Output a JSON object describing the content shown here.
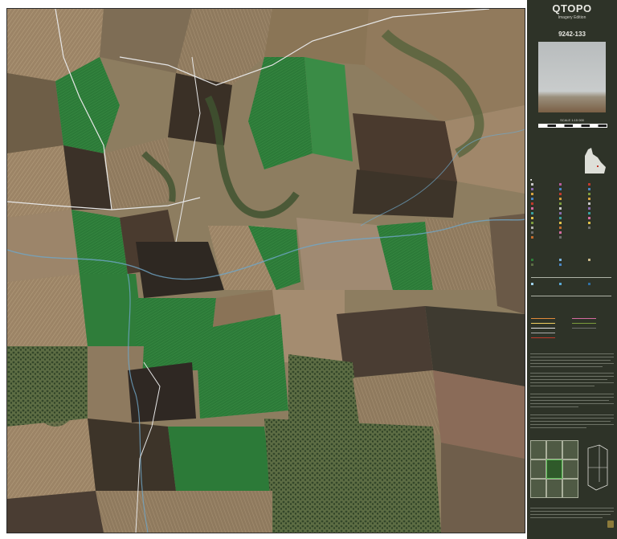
{
  "map": {
    "title": "QTOPO",
    "subtitle": "Imagery Edition",
    "sheet_number": "9242-133",
    "scale": "SCALE 1:15 000"
  },
  "colors": {
    "legend_bg": "#2e3328",
    "field_green": "#2f7d3a",
    "field_dark": "#3a3026",
    "field_tan": "#a88e6a",
    "road": "#e6e6e6",
    "creek": "#5aa9d6"
  },
  "icons": [
    "map-photo",
    "queensland-locator-icon",
    "queensland-government-logo"
  ]
}
